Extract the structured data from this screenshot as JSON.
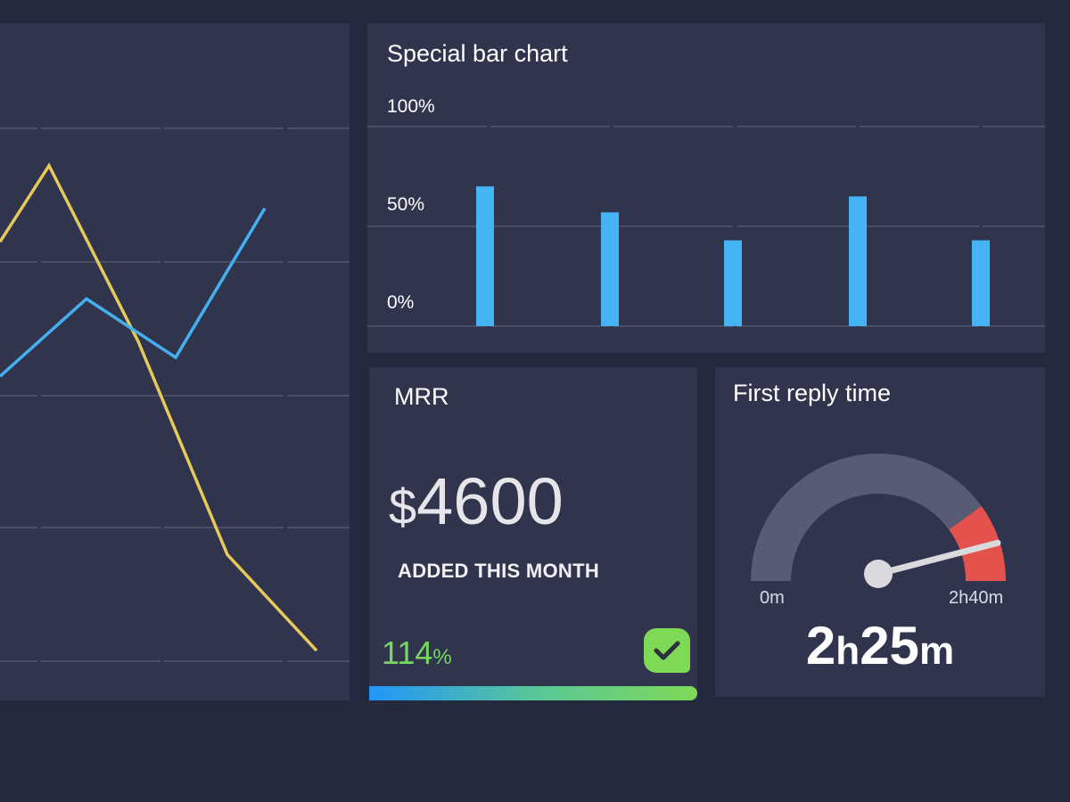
{
  "line_chart": {
    "chart_data": {
      "type": "line",
      "title": "",
      "x": [
        1,
        2,
        3,
        4,
        5,
        6
      ],
      "ylim": [
        0,
        100
      ],
      "grid": true,
      "series": [
        {
          "color": "#e6c95a",
          "values": [
            67,
            93,
            60,
            20,
            2
          ]
        },
        {
          "color": "#44b0f0",
          "values": [
            53,
            68,
            57,
            85
          ]
        }
      ]
    }
  },
  "bar_chart": {
    "title": "Special bar chart",
    "chart_data": {
      "type": "bar",
      "title": "Special bar chart",
      "categories": [
        "",
        "",
        "",
        "",
        ""
      ],
      "values": [
        70,
        57,
        43,
        65,
        43
      ],
      "ylim": [
        0,
        100
      ],
      "yticks": [
        "100%",
        "50%",
        "0%"
      ],
      "color": "#44b4f5",
      "grid": true
    }
  },
  "mrr": {
    "title": "MRR",
    "currency": "$",
    "amount": "4600",
    "subtitle": "ADDED THIS MONTH",
    "percent_value": "114",
    "percent_sign": "%",
    "progress": 1.0,
    "status_icon": "check-icon"
  },
  "reply_time": {
    "title": "First reply time",
    "min_label": "0m",
    "max_label": "2h40m",
    "value_hours": "2",
    "hour_unit": "h",
    "value_minutes": "25",
    "minute_unit": "m",
    "fraction": 0.906,
    "danger_start": 0.8,
    "colors": {
      "track": "#575c72",
      "danger": "#e5524e",
      "needle": "#d9d9de"
    }
  }
}
